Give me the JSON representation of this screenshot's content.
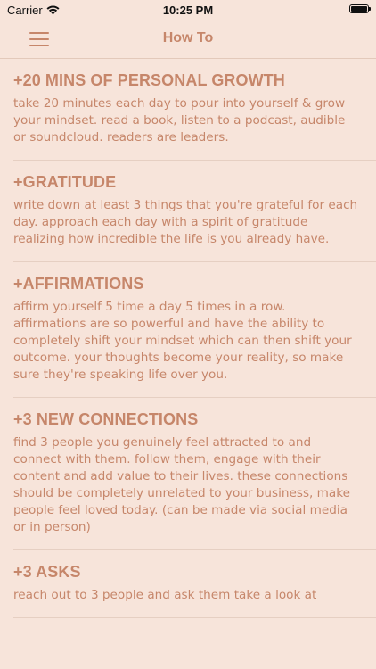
{
  "status_bar": {
    "carrier": "Carrier",
    "time": "10:25 PM"
  },
  "nav": {
    "title": "How To"
  },
  "sections": [
    {
      "title": "+20 MINS OF PERSONAL GROWTH",
      "body": "take 20 minutes each day to pour into yourself & grow your mindset. read a book, listen to a podcast, audible or soundcloud. readers are leaders."
    },
    {
      "title": "+GRATITUDE",
      "body": "write down at least 3 things that you're grateful for each day. approach each day with a spirit of gratitude realizing how incredible the life is you already have."
    },
    {
      "title": "+AFFIRMATIONS",
      "body": "affirm yourself 5 time a day 5 times in a row. affirmations are so powerful and have the ability to completely shift your mindset which can then shift your outcome. your thoughts become your reality, so make sure they're speaking life over you."
    },
    {
      "title": "+3 NEW CONNECTIONS",
      "body": "find 3 people you genuinely feel attracted to and connect with them. follow them, engage with their content and add value to their lives. these connections should be completely unrelated to your business, make people feel loved today. (can be made via social media or in person)"
    },
    {
      "title": "+3 ASKS",
      "body": "reach out to 3 people and ask them take a look at"
    }
  ],
  "colors": {
    "background": "#f7e4da",
    "accent": "#c6866a"
  }
}
